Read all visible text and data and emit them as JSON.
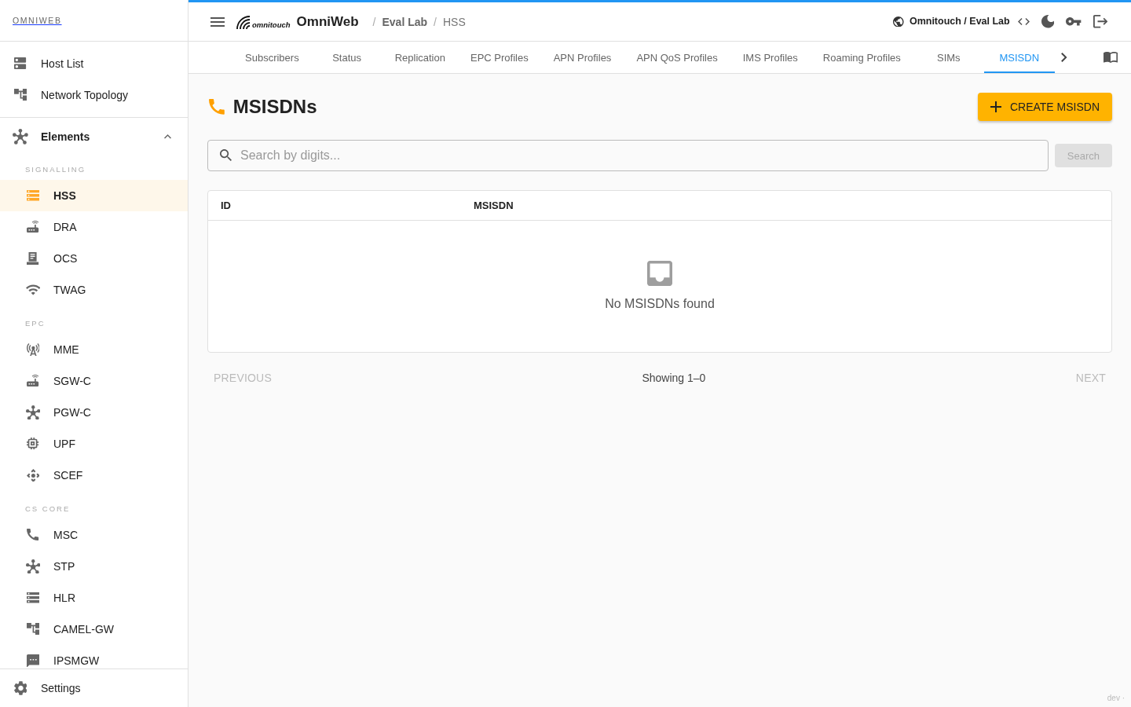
{
  "sidebar": {
    "brand": "OMNIWEB",
    "top_items": [
      {
        "label": "Host List",
        "selected": false
      },
      {
        "label": "Network Topology",
        "selected": false
      }
    ],
    "group": {
      "label": "Elements",
      "expanded": true,
      "sections": [
        {
          "title": "SIGNALLING",
          "items": [
            {
              "label": "HSS",
              "selected": true
            },
            {
              "label": "DRA",
              "selected": false
            },
            {
              "label": "OCS",
              "selected": false
            },
            {
              "label": "TWAG",
              "selected": false
            }
          ]
        },
        {
          "title": "EPC",
          "items": [
            {
              "label": "MME",
              "selected": false
            },
            {
              "label": "SGW-C",
              "selected": false
            },
            {
              "label": "PGW-C",
              "selected": false
            },
            {
              "label": "UPF",
              "selected": false
            },
            {
              "label": "SCEF",
              "selected": false
            }
          ]
        },
        {
          "title": "CS CORE",
          "items": [
            {
              "label": "MSC",
              "selected": false
            },
            {
              "label": "STP",
              "selected": false
            },
            {
              "label": "HLR",
              "selected": false
            },
            {
              "label": "CAMEL-GW",
              "selected": false
            },
            {
              "label": "IPSMGW",
              "selected": false
            }
          ]
        }
      ]
    },
    "footer_item": {
      "label": "Settings"
    }
  },
  "header": {
    "logo_text": "omnitouch",
    "app_name": "OmniWeb",
    "breadcrumb": [
      {
        "separator": "/",
        "label": "Eval Lab"
      },
      {
        "separator": "/",
        "label": "HSS"
      }
    ],
    "tenant": "Omnitouch / Eval Lab"
  },
  "tabs": [
    {
      "label": "Subscribers",
      "selected": false
    },
    {
      "label": "Status",
      "selected": false
    },
    {
      "label": "Replication",
      "selected": false
    },
    {
      "label": "EPC Profiles",
      "selected": false
    },
    {
      "label": "APN Profiles",
      "selected": false
    },
    {
      "label": "APN QoS Profiles",
      "selected": false
    },
    {
      "label": "IMS Profiles",
      "selected": false
    },
    {
      "label": "Roaming Profiles",
      "selected": false
    },
    {
      "label": "SIMs",
      "selected": false
    },
    {
      "label": "MSISDN",
      "selected": true
    }
  ],
  "page": {
    "title": "MSISDNs",
    "create_button": "CREATE MSISDN",
    "search": {
      "placeholder": "Search by digits...",
      "button": {
        "label": "Search",
        "disabled": true
      }
    },
    "table": {
      "columns": [
        "ID",
        "MSISDN"
      ],
      "empty_message": "No MSISDNs found"
    },
    "pagination": {
      "previous": {
        "label": "PREVIOUS",
        "disabled": true
      },
      "summary": "Showing 1–0",
      "next": {
        "label": "NEXT",
        "disabled": true
      }
    }
  },
  "footer_note": "dev ·"
}
